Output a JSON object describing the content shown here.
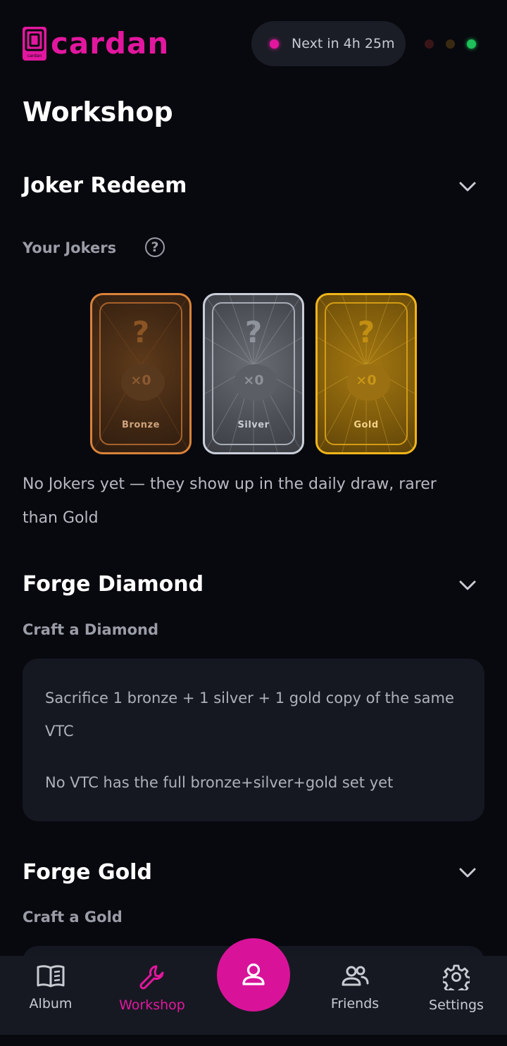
{
  "app": {
    "name": "cardan",
    "logo_small_text": "cardan",
    "accent_color": "#e3179f"
  },
  "header": {
    "timer_text": "Next in 4h 25m",
    "status_colors": [
      "#3a1518",
      "#3a2a12",
      "#1fc25a"
    ]
  },
  "page": {
    "title": "Workshop"
  },
  "joker_section": {
    "title": "Joker Redeem",
    "subtitle": "Your Jokers",
    "help_icon": "?",
    "cards": [
      {
        "tier": "Bronze",
        "count": "×0",
        "symbol": "?"
      },
      {
        "tier": "Silver",
        "count": "×0",
        "symbol": "?"
      },
      {
        "tier": "Gold",
        "count": "×0",
        "symbol": "?"
      }
    ],
    "empty_text_line1": "No Jokers yet — they show up in the daily draw, rarer",
    "empty_text_line2": "than Gold"
  },
  "forge_diamond": {
    "title": "Forge Diamond",
    "subtitle": "Craft a Diamond",
    "description_line1": "Sacrifice 1 bronze + 1 silver + 1 gold copy of the same",
    "description_line2": "VTC",
    "status_text": "No VTC has the full bronze+silver+gold set yet"
  },
  "forge_gold": {
    "title": "Forge Gold",
    "subtitle": "Craft a Gold"
  },
  "bottom_nav": {
    "items": [
      {
        "label": "Album",
        "icon": "book-icon"
      },
      {
        "label": "Workshop",
        "icon": "wrench-icon",
        "active": true
      },
      {
        "label": "",
        "icon": "profile-icon"
      },
      {
        "label": "Friends",
        "icon": "friends-icon"
      },
      {
        "label": "Settings",
        "icon": "gear-icon"
      }
    ]
  }
}
